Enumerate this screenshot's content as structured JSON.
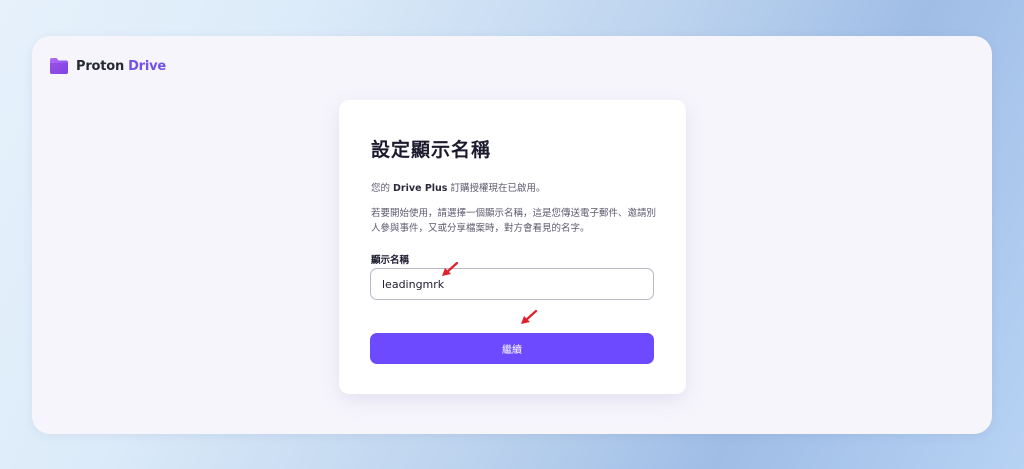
{
  "brand": {
    "name_part1": "Proton",
    "name_part2": "Drive",
    "icon": "folder-logo-icon",
    "accent_color": "#7152e8"
  },
  "card": {
    "title": "設定顯示名稱",
    "intro_prefix": "您的",
    "plan_name": "Drive Plus",
    "intro_suffix": "訂購授權現在已啟用。",
    "description": "若要開始使用，請選擇一個顯示名稱，這是您傳送電子郵件、邀請別人參與事件，又或分享檔案時，對方會看見的名字。"
  },
  "form": {
    "display_name_label": "顯示名稱",
    "display_name_value": "leadingmrk",
    "continue_label": "繼續",
    "button_color": "#6d4aff"
  },
  "annotations": {
    "arrow_icon": "red-arrow-icon",
    "arrow_color": "#e0202a"
  }
}
